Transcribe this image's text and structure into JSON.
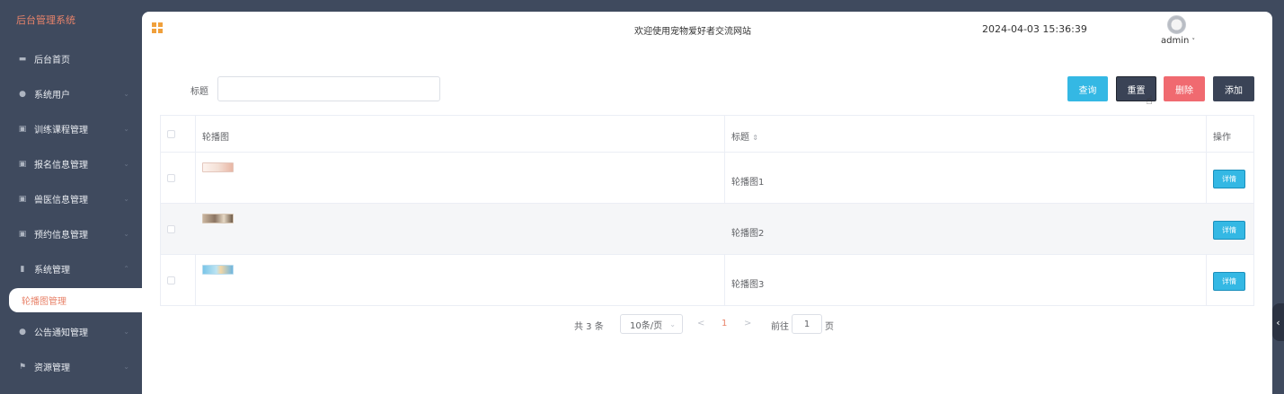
{
  "sidebar": {
    "title": "后台管理系统",
    "items": [
      {
        "label": "后台首页",
        "icon": "monitor-icon",
        "glyph": "▬",
        "arrow": ""
      },
      {
        "label": "系统用户",
        "icon": "user-icon",
        "glyph": "●",
        "arrow": "⌄"
      },
      {
        "label": "训练课程管理",
        "icon": "grid-icon",
        "glyph": "▣",
        "arrow": "⌄"
      },
      {
        "label": "报名信息管理",
        "icon": "grid-icon",
        "glyph": "▣",
        "arrow": "⌄"
      },
      {
        "label": "兽医信息管理",
        "icon": "grid-icon",
        "glyph": "▣",
        "arrow": "⌄"
      },
      {
        "label": "预约信息管理",
        "icon": "grid-icon",
        "glyph": "▣",
        "arrow": "⌄"
      },
      {
        "label": "系统管理",
        "icon": "bar-chart-icon",
        "glyph": "▮",
        "arrow": "⌃"
      }
    ],
    "active_sub": "轮播图管理",
    "items_after": [
      {
        "label": "公告通知管理",
        "icon": "info-icon",
        "glyph": "●",
        "arrow": "⌄"
      },
      {
        "label": "资源管理",
        "icon": "flag-icon",
        "glyph": "⚑",
        "arrow": "⌄"
      }
    ]
  },
  "header": {
    "welcome": "欢迎使用宠物爱好者交流网站",
    "datetime": "2024-04-03 15:36:39",
    "user": "admin",
    "caret": "˅"
  },
  "search": {
    "label": "标题",
    "value": "",
    "placeholder": ""
  },
  "buttons": {
    "query": "查询",
    "reset": "重置",
    "delete": "删除",
    "add": "添加"
  },
  "table": {
    "columns": {
      "image": "轮播图",
      "title": "标题",
      "sort_icon": "⇕",
      "action": "操作"
    },
    "rows": [
      {
        "title": "轮播图1",
        "action": "详情"
      },
      {
        "title": "轮播图2",
        "action": "详情"
      },
      {
        "title": "轮播图3",
        "action": "详情"
      }
    ]
  },
  "pagination": {
    "total": "共 3 条",
    "page_size": "10条/页",
    "prev": "<",
    "current": "1",
    "next": ">",
    "goto_label": "前往",
    "goto_value": "1",
    "page_suffix": "页"
  },
  "colors": {
    "sidebar_bg": "#3f4a5e",
    "accent": "#e8836a",
    "primary": "#34b8e4",
    "danger": "#f06a70"
  }
}
